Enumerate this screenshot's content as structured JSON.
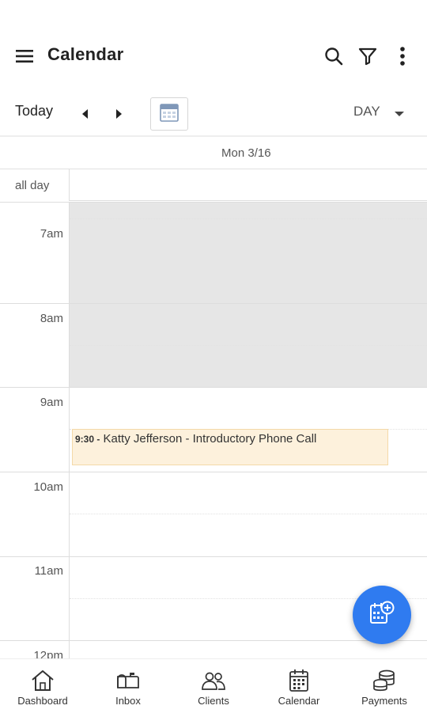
{
  "appbar": {
    "title": "Calendar"
  },
  "toolbar": {
    "today_label": "Today",
    "view_label": "DAY"
  },
  "calendar": {
    "day_header": "Mon 3/16",
    "all_day_label": "all day",
    "hours": [
      "7am",
      "8am",
      "9am",
      "10am",
      "11am",
      "12pm"
    ],
    "event": {
      "time": "9:30 -",
      "title": "Katty Jefferson - Introductory Phone Call"
    }
  },
  "bottom_nav": [
    "Dashboard",
    "Inbox",
    "Clients",
    "Calendar",
    "Payments"
  ],
  "colors": {
    "fab": "#2f7bf0",
    "event_bg": "#fdf1dc",
    "closed_bg": "#e6e6e6"
  }
}
